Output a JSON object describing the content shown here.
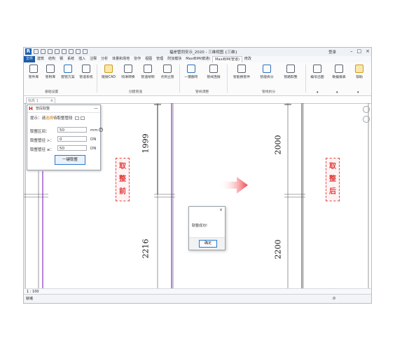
{
  "app": {
    "title": "福岸管同安示_2020 - 三维视图 {三维}",
    "login": "登录",
    "logo": "R"
  },
  "tabs": [
    "文件",
    "建筑",
    "结构",
    "钢",
    "系统",
    "插入",
    "注释",
    "分析",
    "体量和场地",
    "协作",
    "视图",
    "管理",
    "附加模块",
    "MaxiBIM(暖通)",
    "MaxiBIM(管道)",
    "修改"
  ],
  "active_tab_index": 14,
  "ribbon": {
    "buttons": [
      {
        "label": "管件库",
        "icon": "pipe-fitting-icon"
      },
      {
        "label": "管附库",
        "icon": "pipe-accessory-icon"
      },
      {
        "label": "配管方案",
        "icon": "layout-icon"
      },
      {
        "label": "管道系统",
        "icon": "system-icon"
      },
      {
        "label": "链接CAD",
        "icon": "cad-icon"
      },
      {
        "label": "喷淋转换",
        "icon": "sprinkler-icon"
      },
      {
        "label": "管道绘制",
        "icon": "pipe-draw-icon"
      },
      {
        "label": "点到立管",
        "icon": "riser-icon"
      },
      {
        "label": "一键翻弯",
        "icon": "bend-icon"
      },
      {
        "label": "管线连接",
        "icon": "connect-icon"
      },
      {
        "label": "智能换管件",
        "icon": "swap-icon"
      },
      {
        "label": "智能拆分",
        "icon": "split-icon"
      },
      {
        "label": "管路取整",
        "icon": "round-icon"
      },
      {
        "label": "编号出图",
        "icon": "number-icon"
      },
      {
        "label": "数据报表",
        "icon": "report-icon"
      },
      {
        "label": "帮助",
        "icon": "help-icon"
      }
    ],
    "panels": [
      "基础设置",
      "创建管道",
      "管线调整",
      "管线拆分"
    ]
  },
  "view_tab": {
    "label": "标高 1"
  },
  "dialog": {
    "title": "管段取整",
    "hint_prefix": "提示：请",
    "hint_highlight": "选择",
    "hint_suffix": "待取整管段",
    "fields": [
      {
        "label": "取整区间：",
        "value": "50",
        "unit": "mm"
      },
      {
        "label": "取整管径 >：",
        "value": "0",
        "unit": "DN"
      },
      {
        "label": "取整管径 ≤：",
        "value": "50",
        "unit": "DN"
      }
    ],
    "button": "一键取整"
  },
  "labels": {
    "before": [
      "取",
      "整",
      "前"
    ],
    "after": [
      "取",
      "整",
      "后"
    ]
  },
  "dimensions": {
    "left_top": "1999",
    "left_bottom": "2216",
    "right_top": "2000",
    "right_bottom": "2200"
  },
  "message": {
    "text": "取整成功!",
    "ok": "确定"
  },
  "viewbar": {
    "scale": "1 : 100"
  },
  "statusbar": {
    "text": "就绪",
    "filter": ":0"
  },
  "colors": {
    "accent": "#1b5aa8",
    "red_label": "#e23a3a",
    "arrow": "#f0444a"
  }
}
